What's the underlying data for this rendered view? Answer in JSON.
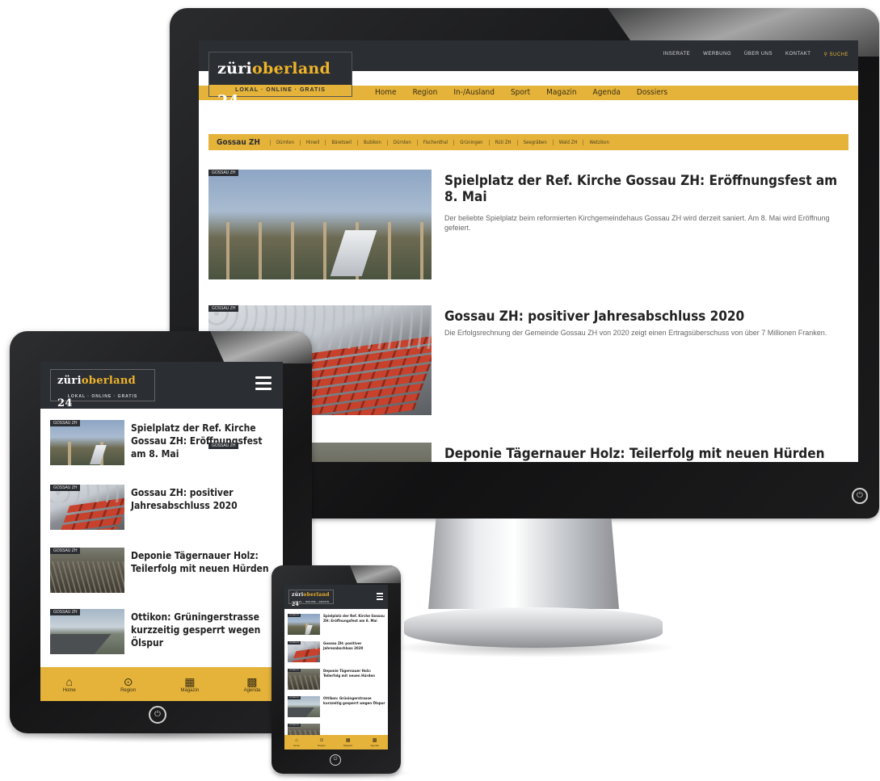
{
  "brand": {
    "name_part1": "züri",
    "name_part2": "oberland",
    "name_part3": " 24",
    "tagline": "LOKAL · ONLINE · GRATIS",
    "accent_color": "#e5b33a",
    "dark_color": "#2b2e33"
  },
  "desktop": {
    "top_links": [
      "INSERATE",
      "WERBUNG",
      "ÜBER UNS",
      "KONTAKT"
    ],
    "search_label": "SUCHE",
    "search_icon": "search-icon",
    "main_nav": [
      "Home",
      "Region",
      "In-/Ausland",
      "Sport",
      "Magazin",
      "Agenda",
      "Dossiers"
    ],
    "subnav_current": "Gossau ZH",
    "subnav_items": [
      "Dürnten",
      "Hinwil",
      "Bäretswil",
      "Bubikon",
      "Dürnten",
      "Fischenthal",
      "Grüningen",
      "Rüti ZH",
      "Seegräben",
      "Wald ZH",
      "Wetzikon"
    ],
    "articles": [
      {
        "tag": "GOSSAU ZH",
        "title": "Spielplatz der Ref. Kirche Gossau ZH: Eröffnungsfest am 8. Mai",
        "teaser": "Der beliebte Spielplatz beim reformierten Kirchgemeindehaus Gossau ZH wird derzeit saniert. Am 8. Mai wird Eröffnung gefeiert."
      },
      {
        "tag": "GOSSAU ZH",
        "title": "Gossau ZH: positiver Jahresabschluss 2020",
        "teaser": "Die Erfolgsrechnung der Gemeinde Gossau ZH von 2020 zeigt einen Ertragsüberschuss von über 7 Millionen Franken."
      },
      {
        "tag": "GOSSAU ZH",
        "title": "Deponie Tägernauer Holz: Teilerfolg mit neuen Hürden",
        "teaser": ""
      }
    ]
  },
  "tablet": {
    "menu_icon": "hamburger-icon",
    "articles": [
      {
        "tag": "GOSSAU ZH",
        "title": "Spielplatz der Ref. Kirche Gossau ZH: Eröffnungsfest am 8. Mai"
      },
      {
        "tag": "GOSSAU ZH",
        "title": "Gossau ZH: positiver Jahresabschluss 2020"
      },
      {
        "tag": "GOSSAU ZH",
        "title": "Deponie Tägernauer Holz: Teilerfolg mit neuen Hürden"
      },
      {
        "tag": "GOSSAU ZH",
        "title": "Ottikon: Grüningerstrasse kurzzeitig gesperrt wegen Ölspur"
      }
    ],
    "footer_nav": [
      {
        "label": "Home",
        "icon": "home-icon"
      },
      {
        "label": "Region",
        "icon": "location-pin-icon"
      },
      {
        "label": "Magazin",
        "icon": "magazine-icon"
      },
      {
        "label": "Agenda",
        "icon": "calendar-icon"
      }
    ]
  },
  "phone": {
    "articles": [
      {
        "tag": "GOSSAU ZH",
        "title": "Spielplatz der Ref. Kirche Gossau ZH: Eröffnungsfest am 8. Mai"
      },
      {
        "tag": "GOSSAU ZH",
        "title": "Gossau ZH: positiver Jahresabschluss 2020"
      },
      {
        "tag": "GOSSAU ZH",
        "title": "Deponie Tägernauer Holz: Teilerfolg mit neuen Hürden"
      },
      {
        "tag": "GOSSAU ZH",
        "title": "Ottikon: Grüningerstrasse kurzzeitig gesperrt wegen Ölspur"
      },
      {
        "tag": "GOSSAU ZH",
        "title": ""
      }
    ],
    "footer_nav": [
      {
        "label": "Home",
        "icon": "home-icon"
      },
      {
        "label": "Region",
        "icon": "location-pin-icon"
      },
      {
        "label": "Magazin",
        "icon": "magazine-icon"
      },
      {
        "label": "Agenda",
        "icon": "calendar-icon"
      }
    ]
  }
}
